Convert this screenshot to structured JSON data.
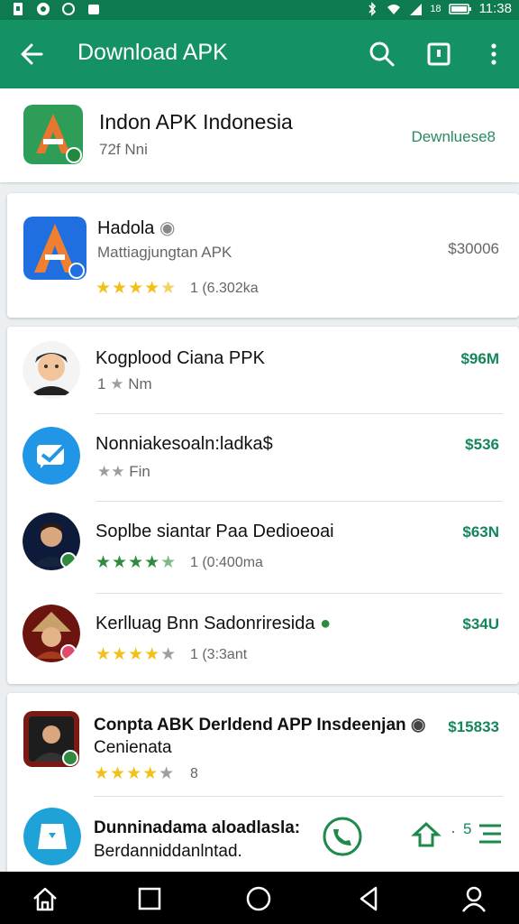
{
  "status": {
    "time": "11:38",
    "battery": "18"
  },
  "app_bar": {
    "title": "Download APK",
    "back_icon": "arrow-back-icon",
    "search_icon": "search-icon",
    "square_icon": "open-in-icon",
    "menu_icon": "more-vert-icon"
  },
  "header_item": {
    "name": "Indon APK Indonesia",
    "sub": "72f Nni",
    "action": "Dewnluese8"
  },
  "featured": {
    "name": "Hadola",
    "sub": "Mattiagjungtan APK",
    "price": "$30006",
    "rating": 4.5,
    "count": "1 (6.302ka"
  },
  "list": [
    {
      "name": "Kogplood Ciana PPK",
      "sub": "Nm",
      "price": "$96M",
      "rating": 1,
      "rating_max": 2,
      "count": "",
      "lead": "1"
    },
    {
      "name": "Nonniakesoaln:ladka$",
      "sub": "Fin",
      "price": "$536",
      "rating": 0,
      "rating_max": 2,
      "count": "",
      "lead": ""
    },
    {
      "name": "Soplbe siantar Paa Dedioeoai",
      "sub": "",
      "price": "$63N",
      "rating": 4.5,
      "count": "1 (0:400ma"
    },
    {
      "name": "Kerlluag Bnn Sadonriresida",
      "sub": "",
      "price": "$34U",
      "rating": 4,
      "count": "1 (3:3ant"
    }
  ],
  "bottom_list": [
    {
      "name": "Conpta ABK Derldend APP Insdeenjan",
      "name2": "Cenienata",
      "price": "$15833",
      "rating": 4,
      "count": "8"
    },
    {
      "name": "Dunninadama aloadlasla:",
      "name2": "Berdanniddanlntad.",
      "price": "5"
    }
  ],
  "colors": {
    "accent": "#149264",
    "status_bar": "#0d7a4f",
    "price_green": "#14875a",
    "star_yellow": "#f2c018"
  }
}
